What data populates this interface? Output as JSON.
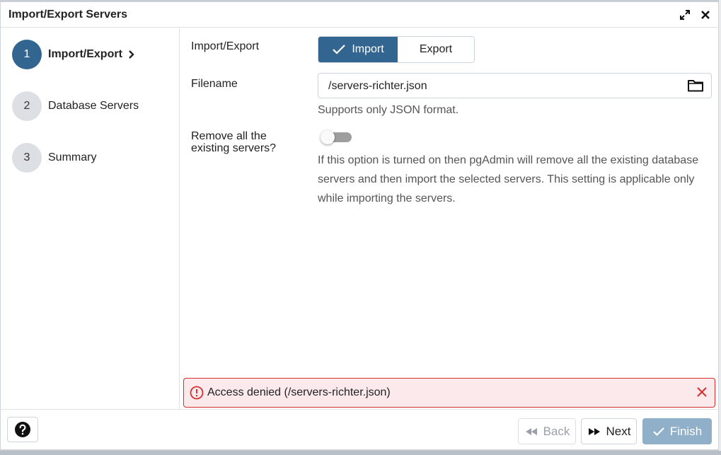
{
  "dialog": {
    "title": "Import/Export Servers"
  },
  "steps": [
    {
      "number": "1",
      "label": "Import/Export",
      "active": true
    },
    {
      "number": "2",
      "label": "Database Servers",
      "active": false
    },
    {
      "number": "3",
      "label": "Summary",
      "active": false
    }
  ],
  "form": {
    "import_export_label": "Import/Export",
    "import_label": "Import",
    "export_label": "Export",
    "selected_mode": "Import",
    "filename_label": "Filename",
    "filename_value": "/servers-richter.json",
    "filename_hint": "Supports only JSON format.",
    "remove_label_line1": "Remove all the",
    "remove_label_line2": "existing servers?",
    "remove_enabled": false,
    "remove_help": "If this option is turned on then pgAdmin will remove all the existing database servers and then import the selected servers. This setting is applicable only while importing the servers."
  },
  "error": {
    "message": "Access denied (/servers-richter.json)"
  },
  "footer": {
    "back_label": "Back",
    "next_label": "Next",
    "finish_label": "Finish"
  },
  "colors": {
    "primary": "#326690",
    "error_border": "#d32f2f",
    "error_bg": "#fbe9ec",
    "finish_disabled": "#8fb0c8"
  }
}
